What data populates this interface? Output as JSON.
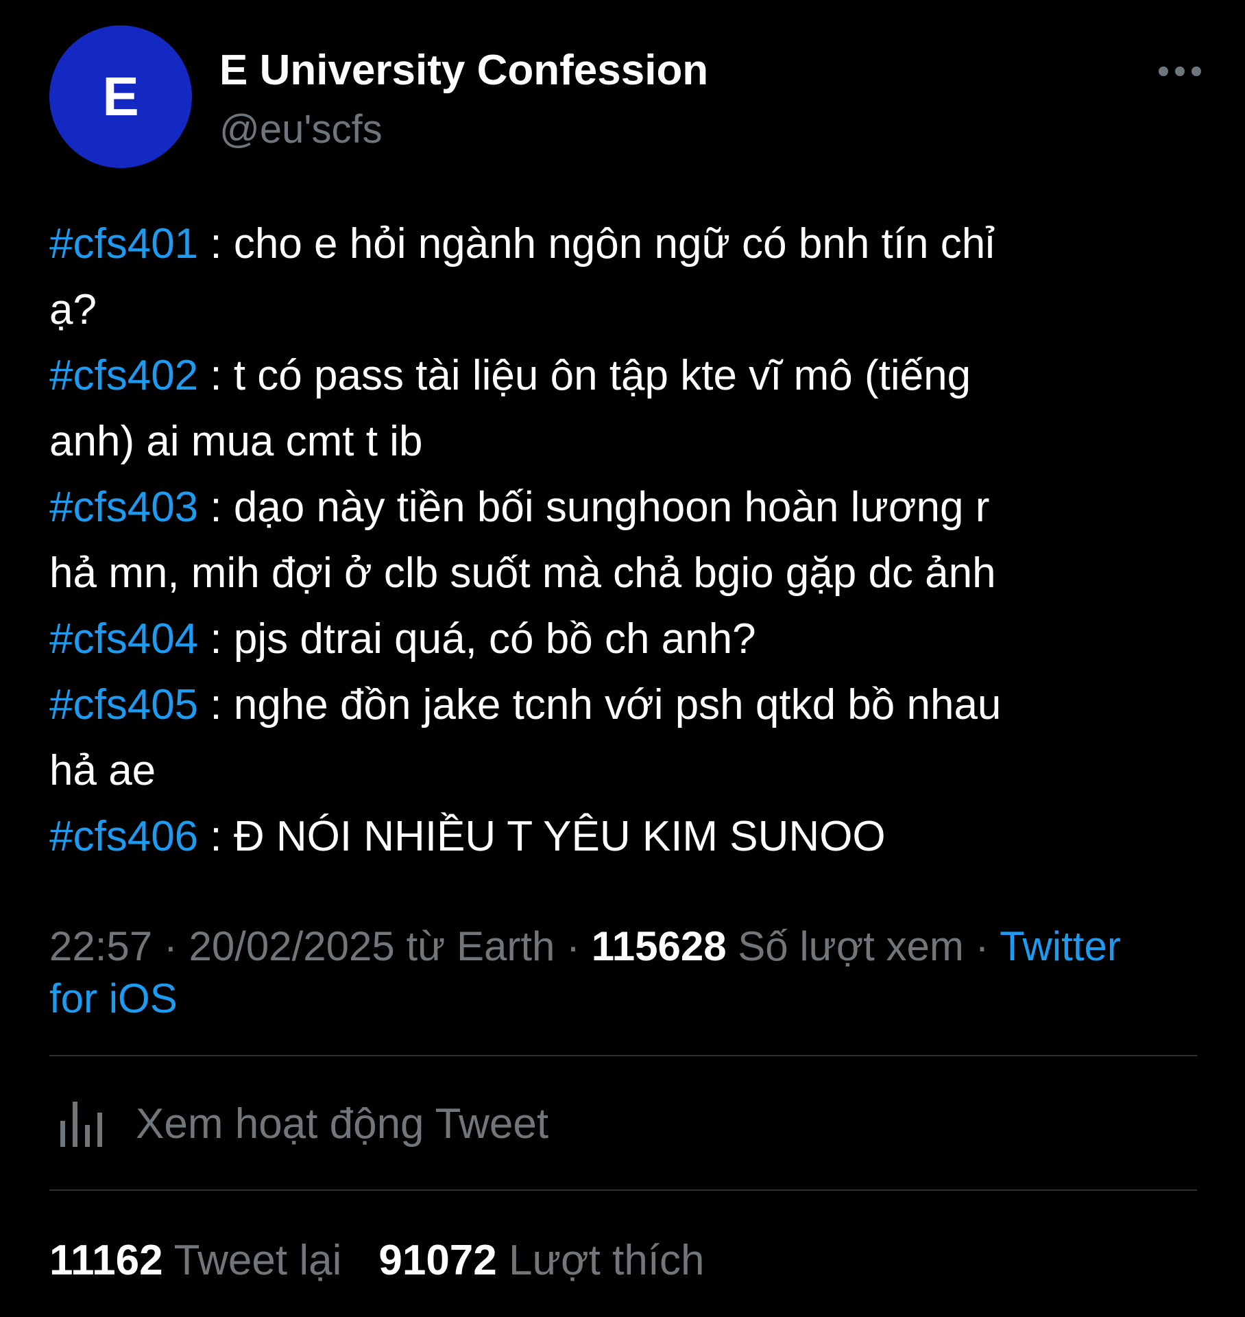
{
  "author": {
    "avatar_letter": "E",
    "avatar_color": "#1428c2",
    "display_name": "E University Confession",
    "handle": "@eu'scfs"
  },
  "more_icon": "more-horizontal-icon",
  "tweet": {
    "lines": [
      {
        "tag": "#cfs401",
        "text": " : cho e hỏi ngành ngôn ngữ có bnh tín chỉ"
      },
      {
        "tag": "",
        "text": "ạ?"
      },
      {
        "tag": "#cfs402",
        "text": " : t có pass tài liệu ôn tập kte vĩ mô (tiếng"
      },
      {
        "tag": "",
        "text": "anh) ai mua cmt t ib"
      },
      {
        "tag": "#cfs403",
        "text": " : dạo này tiền bối sunghoon hoàn lương r"
      },
      {
        "tag": "",
        "text": "hả mn, mih đợi ở clb suốt mà chả bgio gặp dc ảnh"
      },
      {
        "tag": "#cfs404",
        "text": " : pjs dtrai quá, có bồ ch anh?"
      },
      {
        "tag": "#cfs405",
        "text": " : nghe đồn jake tcnh với psh qtkd bồ nhau"
      },
      {
        "tag": "",
        "text": "hả ae"
      },
      {
        "tag": "#cfs406",
        "text": " : Đ NÓI NHIỀU T YÊU KIM SUNOO"
      }
    ]
  },
  "meta": {
    "time": "22:57",
    "sep1": " · ",
    "date": "20/02/2025",
    "location_text": " từ Earth",
    "sep2": " · ",
    "views": "115628",
    "views_label": " Số lượt xem",
    "sep3": " · ",
    "source_line1": "Twitter",
    "source_line2": "for iOS"
  },
  "activity": {
    "icon": "analytics-bar-chart-icon",
    "label": "Xem hoạt động Tweet"
  },
  "stats": {
    "retweets_count": "11162",
    "retweets_label": " Tweet lại",
    "likes_count": "91072",
    "likes_label": " Lượt thích"
  },
  "colors": {
    "background": "#000000",
    "text": "#ffffff",
    "muted": "#71767b",
    "accent": "#1d9bf0",
    "divider": "#2f3336"
  }
}
